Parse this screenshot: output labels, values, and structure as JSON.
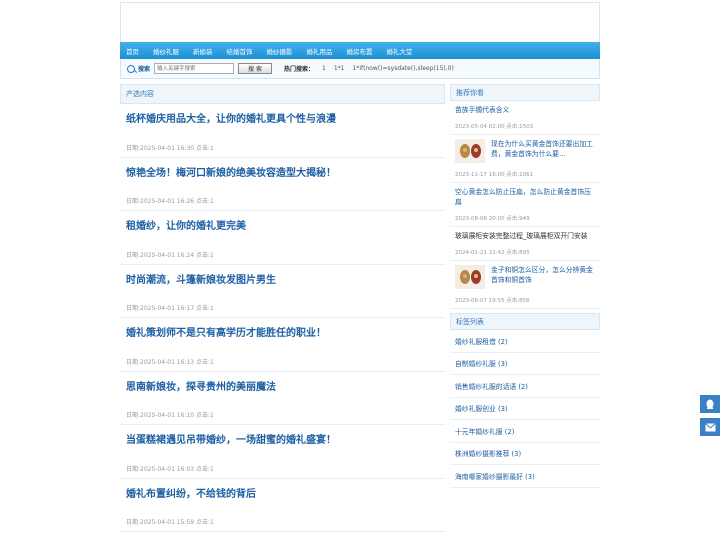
{
  "nav": [
    "首页",
    "婚纱礼服",
    "新娘装",
    "结婚首饰",
    "婚纱摄影",
    "婚礼用品",
    "婚房布置",
    "婚礼大堂"
  ],
  "search": {
    "label": "搜索",
    "placeholder": "输入关键字搜索",
    "button": "搜 索",
    "hot_label": "热门搜索：",
    "hot_items": [
      "1",
      "1*1",
      "1*if(now()=sysdate(),sleep(15),0)"
    ]
  },
  "main": {
    "title": "产选内容",
    "articles": [
      {
        "title": "纸杯婚庆用品大全，让你的婚礼更具个性与浪漫",
        "meta": "日期:2025-04-01 16:30  点击:1"
      },
      {
        "title": "惊艳全场！梅河口新娘的绝美妆容造型大揭秘！",
        "meta": "日期:2025-04-01 16:26  点击:1"
      },
      {
        "title": "租婚纱，让你的婚礼更完美",
        "meta": "日期:2025-04-01 16:24  点击:1"
      },
      {
        "title": "时尚潮流，斗篷新娘妆发图片男生",
        "meta": "日期:2025-04-01 16:17  点击:1"
      },
      {
        "title": "婚礼策划师不是只有高学历才能胜任的职业！",
        "meta": "日期:2025-04-01 16:13  点击:1"
      },
      {
        "title": "思南新娘妆，探寻贵州的美丽魔法",
        "meta": "日期:2025-04-01 16:10  点击:1"
      },
      {
        "title": "当蛋糕裙遇见吊带婚纱，一场甜蜜的婚礼盛宴！",
        "meta": "日期:2025-04-01 16:03  点击:1"
      },
      {
        "title": "婚礼布置纠纷，不给钱的背后",
        "meta": "日期:2025-04-01 15:59  点击:1"
      }
    ]
  },
  "side": {
    "rec_title": "推荐你看",
    "recs": [
      {
        "title": "苗族手镯代表含义",
        "meta": "2023-05-04 02:00  点击:1503",
        "thumb": false,
        "dark": false
      },
      {
        "title": "现在为什么买黄金首饰还要出加工费，黄金首饰为什么要...",
        "meta": "2023-11-17 16:00  点击:1061",
        "thumb": true,
        "dark": false
      },
      {
        "title": "空心黄金怎么防止压扁，怎么防止黄金首饰压扁",
        "meta": "2023-08-06 20:00  点击:949",
        "thumb": false,
        "dark": false
      },
      {
        "title": "玻璃展柜安装完整过程_玻璃展柜双开门安装",
        "meta": "2024-01-21 22:42  点击:895",
        "thumb": false,
        "dark": true
      },
      {
        "title": "金子和铜怎么区分，怎么分辨黄金首饰和铜首饰",
        "meta": "2023-06-07 19:55  点击:856",
        "thumb": true,
        "dark": false
      }
    ],
    "tags_title": "标签列表",
    "tags": [
      "婚纱礼服租借 (2)",
      "自制婚纱礼服 (3)",
      "销售婚纱礼服的话语 (2)",
      "婚纱礼服创业 (3)",
      "十元年婚纱礼服 (2)",
      "株洲婚纱摄影推荐 (3)",
      "海南哪家婚纱摄影最好 (3)"
    ]
  },
  "icons": {
    "float_top": "qq-icon",
    "float_bottom": "mail-icon"
  }
}
